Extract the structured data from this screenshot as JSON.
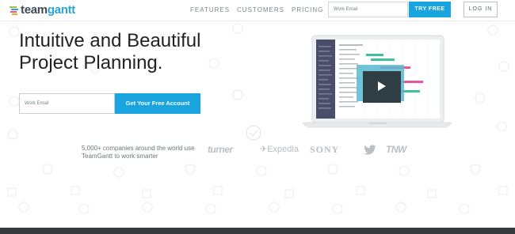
{
  "brand": {
    "logo_prefix": "team",
    "logo_suffix": "gantt"
  },
  "nav": {
    "items": [
      "FEATURES",
      "CUSTOMERS",
      "PRICING"
    ],
    "email_placeholder": "Work Email",
    "try_free_label": "TRY FREE",
    "login_label": "LOG IN"
  },
  "hero": {
    "headline_line1": "Intuitive and Beautiful",
    "headline_line2": "Project Planning.",
    "email_placeholder": "Work Email",
    "cta_label": "Get Your Free Account"
  },
  "social_proof": {
    "text_line1": "5,000+ companies around the world use",
    "text_line2": "TeamGantt to work smarter",
    "logos": [
      "turner",
      "Expedia",
      "SONY",
      "twitter-logo",
      "TNW"
    ]
  },
  "colors": {
    "accent": "#19a4e0",
    "dark_footer": "#33393d",
    "logo_text": "#3e4a52"
  }
}
